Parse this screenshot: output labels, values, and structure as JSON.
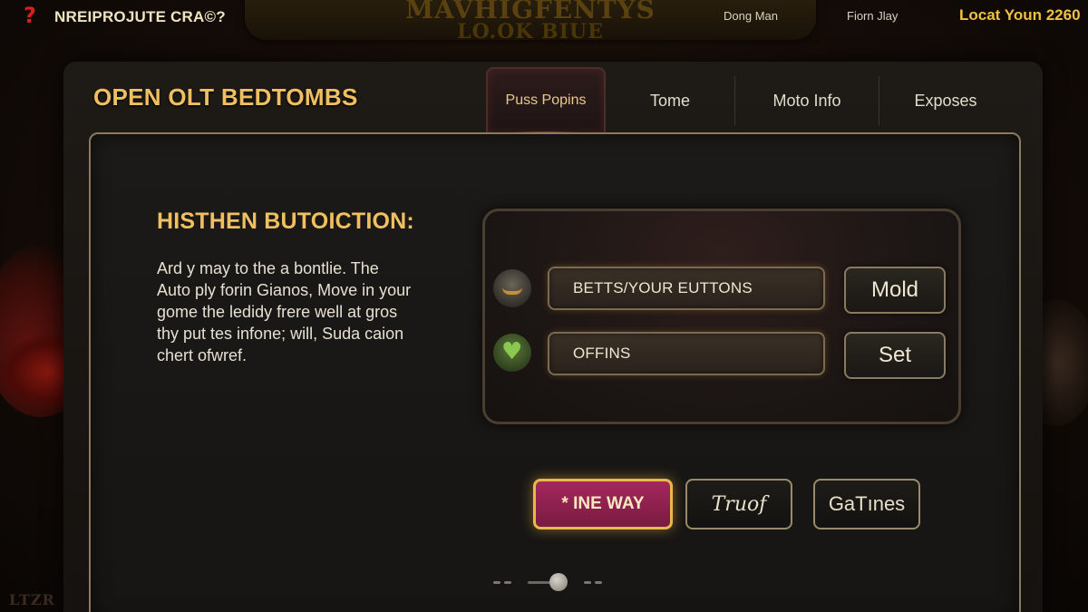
{
  "topbar": {
    "help_icon": "question-mark-icon",
    "app_title": "NREIPROJUTE CRA©?",
    "banner_line1": "MAVHIGFENTYS",
    "banner_line2": "LO.OK BIUE",
    "link1": "Dong Man",
    "link2": "Fiorn Jlay",
    "status": "Locat Youn 2260"
  },
  "header": {
    "title": "OPEN OLT BEDTOMBS",
    "tabs": [
      {
        "label": "Puss Popins",
        "active": true
      },
      {
        "label": "Tome"
      },
      {
        "label": "Moto Info"
      },
      {
        "label": "Exposes"
      }
    ]
  },
  "content": {
    "heading": "HISTHEN BUTOICTION:",
    "body_lines": [
      "Ard y may to the a bontlie. The",
      "Auto ply forin Gianos,  Move in your",
      "gome the ledidy frere well at gros",
      "thy put tes infone; will, Suda caion",
      "chert ofwref."
    ]
  },
  "settings": {
    "row1": {
      "icon": "crown-badge-icon",
      "field_value": "BETTS/YOUR EUTTONS",
      "button_label": "Mold"
    },
    "row2": {
      "icon": "heart-badge-icon",
      "field_value": "OFFINS",
      "button_label": "Set"
    }
  },
  "actions": {
    "primary_label": "* INE WAY",
    "secondary1_label": "Truof",
    "secondary2_label": "GaTınes"
  },
  "pager": {
    "position": 0.5
  },
  "colors": {
    "accent_gold": "#f0c060",
    "primary_button": "#a4285c",
    "background": "#140c08"
  },
  "decor": {
    "corner_text": "LTZR"
  }
}
